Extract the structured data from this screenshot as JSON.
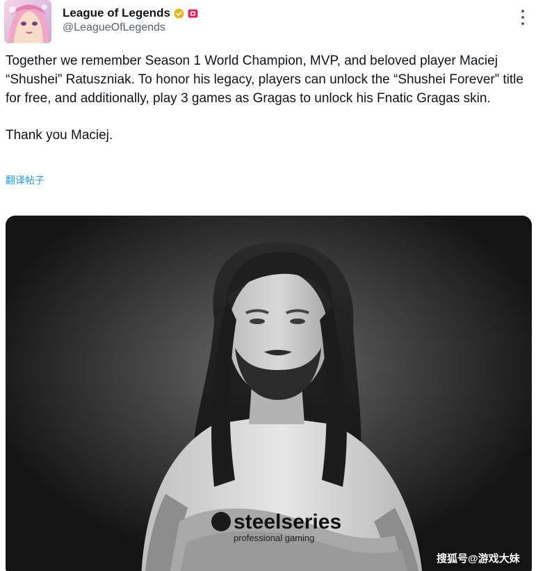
{
  "account": {
    "display_name": "League of Legends",
    "handle": "@LeagueOfLegends",
    "verified_badge_color": "#e2b719",
    "affiliate_badge_color": "#e0245e"
  },
  "tweet": {
    "paragraphs": [
      "Together we remember Season 1 World Champion, MVP, and beloved player Maciej “Shushei” Ratuszniak. To honor his legacy, players can unlock the “Shushei Forever” title for free, and additionally, play 3 games as Gragas to unlock his Fnatic Gragas skin.",
      "Thank you Maciej."
    ],
    "translate_label": "翻译帖子"
  },
  "media": {
    "shirt_text_brand": "steelseries",
    "shirt_text_sub": "professional gaming",
    "style": "black-and-white portrait"
  },
  "watermark": {
    "text": "搜狐号@游戏大妹"
  },
  "icons": {
    "more": "more-vertical-icon",
    "verified": "verified-badge-icon",
    "affiliate": "affiliate-badge-icon"
  },
  "colors": {
    "text_primary": "#0f1419",
    "text_secondary": "#536471",
    "link": "#1d9bf0"
  }
}
